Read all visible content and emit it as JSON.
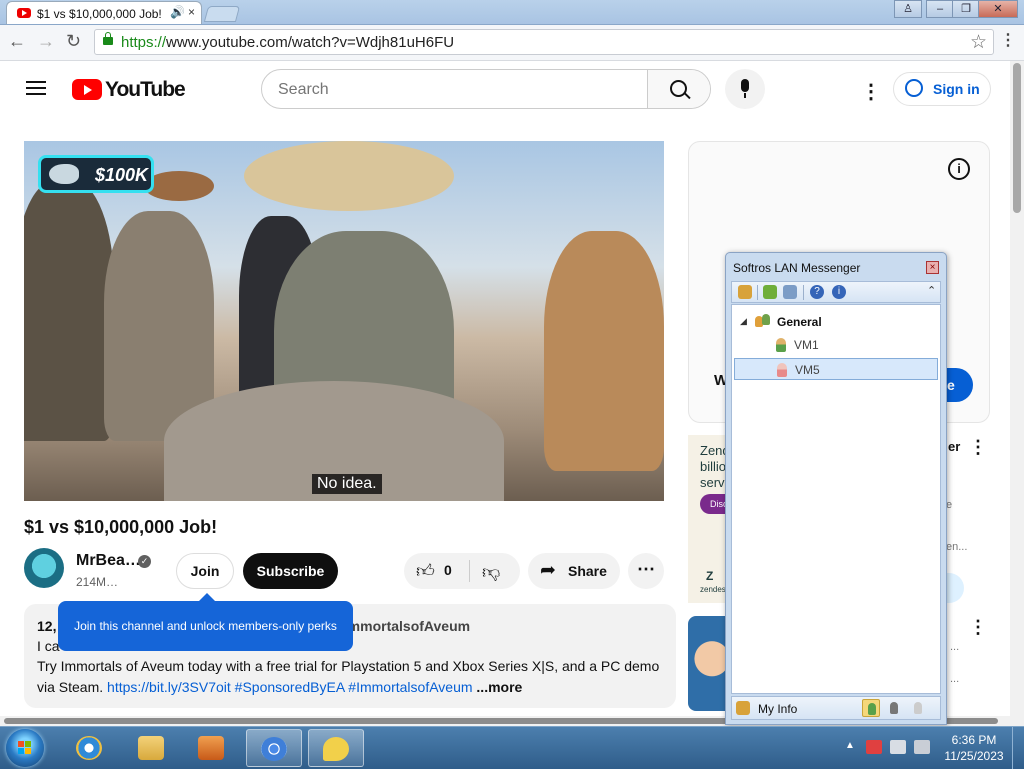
{
  "browser": {
    "tab_title": "$1 vs $10,000,000 Job!",
    "url_scheme": "https://",
    "url_rest": "www.youtube.com/watch?v=Wdjh81uH6FU",
    "tab_audio_icon": "speaker-icon",
    "tab_close_glyph": "×"
  },
  "window_controls": {
    "user": "♙",
    "minimize": "–",
    "restore": "❐",
    "close": "✕"
  },
  "youtube": {
    "logo_text": "YouTube",
    "search_placeholder": "Search",
    "signin_label": "Sign in",
    "video": {
      "badge_amount": "$100K",
      "caption": "No idea."
    },
    "title": "$1 vs $10,000,000 Job!",
    "channel": {
      "name": "MrBea…",
      "subscribers": "214M…",
      "verified_glyph": "✓"
    },
    "join_label": "Join",
    "subscribe_label": "Subscribe",
    "like_count": "0",
    "share_label": "Share",
    "tooltip_text": "Join this channel and unlock members-only perks",
    "description": {
      "stats_prefix": "12,",
      "hashtags_peek": "#ImmortalsofAveum",
      "line1_peek": "I ca",
      "line2": "Try Immortals of Aveum today with a free trial for Playstation 5 and Xbox Series X|S, and a PC demo",
      "line3_prefix": "via Steam.",
      "line3_link": "https://bit.ly/3SV7oit",
      "line3_tag1": "#SponsoredByEA",
      "line3_tag2": "#ImmortalsofAveum",
      "more_label": "...more"
    },
    "ad_card_letter": "W",
    "ad_button_peek": "e",
    "zendesk": {
      "line1": "Zend",
      "line2": "billio",
      "line3": "servi",
      "disc_label": "Disc",
      "logo": "Z",
      "logo_sub": "zendes",
      "peek_title": "er",
      "peek_grey1": "e",
      "peek_grey2": "",
      "peek_grey3": "en...",
      "peek_grey4": "n"
    },
    "rec_peek_dots": "..."
  },
  "messenger": {
    "title": "Softros LAN Messenger",
    "close_glyph": "×",
    "group_name": "General",
    "group_toggle": "◢",
    "users": [
      "VM1",
      "VM5"
    ],
    "selected_user": "VM5",
    "myinfo_label": "My Info",
    "collapse_glyph": "⌃"
  },
  "taskbar": {
    "time": "6:36 PM",
    "date": "11/25/2023",
    "tray_up_glyph": "▲"
  },
  "colors": {
    "youtube_red": "#ff0000",
    "link_blue": "#065fd4",
    "tooltip_blue": "#1565d8",
    "subscribe_black": "#0f0f0f"
  }
}
